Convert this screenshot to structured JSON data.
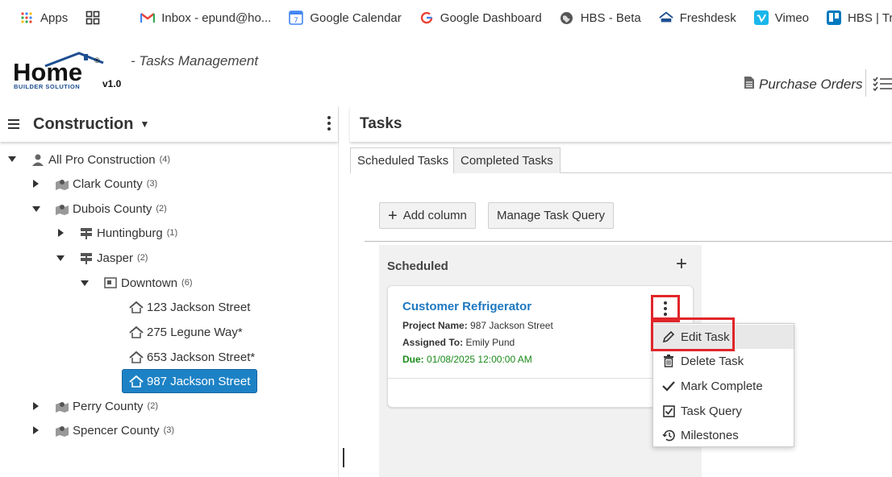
{
  "bookmarks": [
    {
      "label": "Apps",
      "icon": "apps-grid-icon"
    },
    {
      "label": "",
      "icon": "tab-grid-icon"
    },
    {
      "label": "Inbox - epund@ho...",
      "icon": "gmail-icon"
    },
    {
      "label": "Google Calendar",
      "icon": "google-calendar-icon"
    },
    {
      "label": "Google Dashboard",
      "icon": "google-icon"
    },
    {
      "label": "HBS - Beta",
      "icon": "globe-icon"
    },
    {
      "label": "Freshdesk",
      "icon": "home-logo-icon"
    },
    {
      "label": "Vimeo",
      "icon": "vimeo-icon"
    },
    {
      "label": "HBS | Trello",
      "icon": "trello-icon"
    }
  ],
  "header": {
    "logo_text": "Home",
    "logo_sub": "BUILDER SOLUTION",
    "logo_version": "v1.0",
    "subtitle": "- Tasks Management",
    "purchase_orders": "Purchase Orders"
  },
  "left": {
    "title": "Construction",
    "tree": [
      {
        "label": "All Pro Construction",
        "count": "(4)",
        "icon": "person-icon"
      },
      {
        "label": "Clark County",
        "count": "(3)",
        "icon": "map-pin-icon"
      },
      {
        "label": "Dubois County",
        "count": "(2)",
        "icon": "map-pin-icon"
      },
      {
        "label": "Huntingburg",
        "count": "(1)",
        "icon": "signpost-icon"
      },
      {
        "label": "Jasper",
        "count": "(2)",
        "icon": "signpost-icon"
      },
      {
        "label": "Downtown",
        "count": "(6)",
        "icon": "subdivision-icon"
      },
      {
        "label": "123 Jackson Street",
        "count": "",
        "icon": "house-icon"
      },
      {
        "label": "275 Legune Way*",
        "count": "",
        "icon": "house-icon"
      },
      {
        "label": "653 Jackson Street*",
        "count": "",
        "icon": "house-icon"
      },
      {
        "label": "987 Jackson Street",
        "count": "",
        "icon": "house-icon"
      },
      {
        "label": "Perry County",
        "count": "(2)",
        "icon": "map-pin-icon"
      },
      {
        "label": "Spencer County",
        "count": "(3)",
        "icon": "map-pin-icon"
      }
    ]
  },
  "right": {
    "title": "Tasks",
    "tabs": [
      "Scheduled Tasks",
      "Completed Tasks"
    ],
    "add_column": "Add column",
    "manage_query": "Manage Task Query",
    "column": {
      "title": "Scheduled",
      "card": {
        "title": "Customer Refrigerator",
        "project_label": "Project Name:",
        "project_value": "987 Jackson Street",
        "assigned_label": "Assigned To:",
        "assigned_value": "Emily Pund",
        "due_label": "Due:",
        "due_value": "01/08/2025 12:00:00 AM"
      }
    },
    "menu": [
      "Edit Task",
      "Delete Task",
      "Mark Complete",
      "Task Query",
      "Milestones"
    ]
  },
  "colors": {
    "accent": "#1d82c5",
    "highlight": "#e0262a",
    "due_green": "#1a8a1a",
    "title_blue": "#1d78c1"
  }
}
